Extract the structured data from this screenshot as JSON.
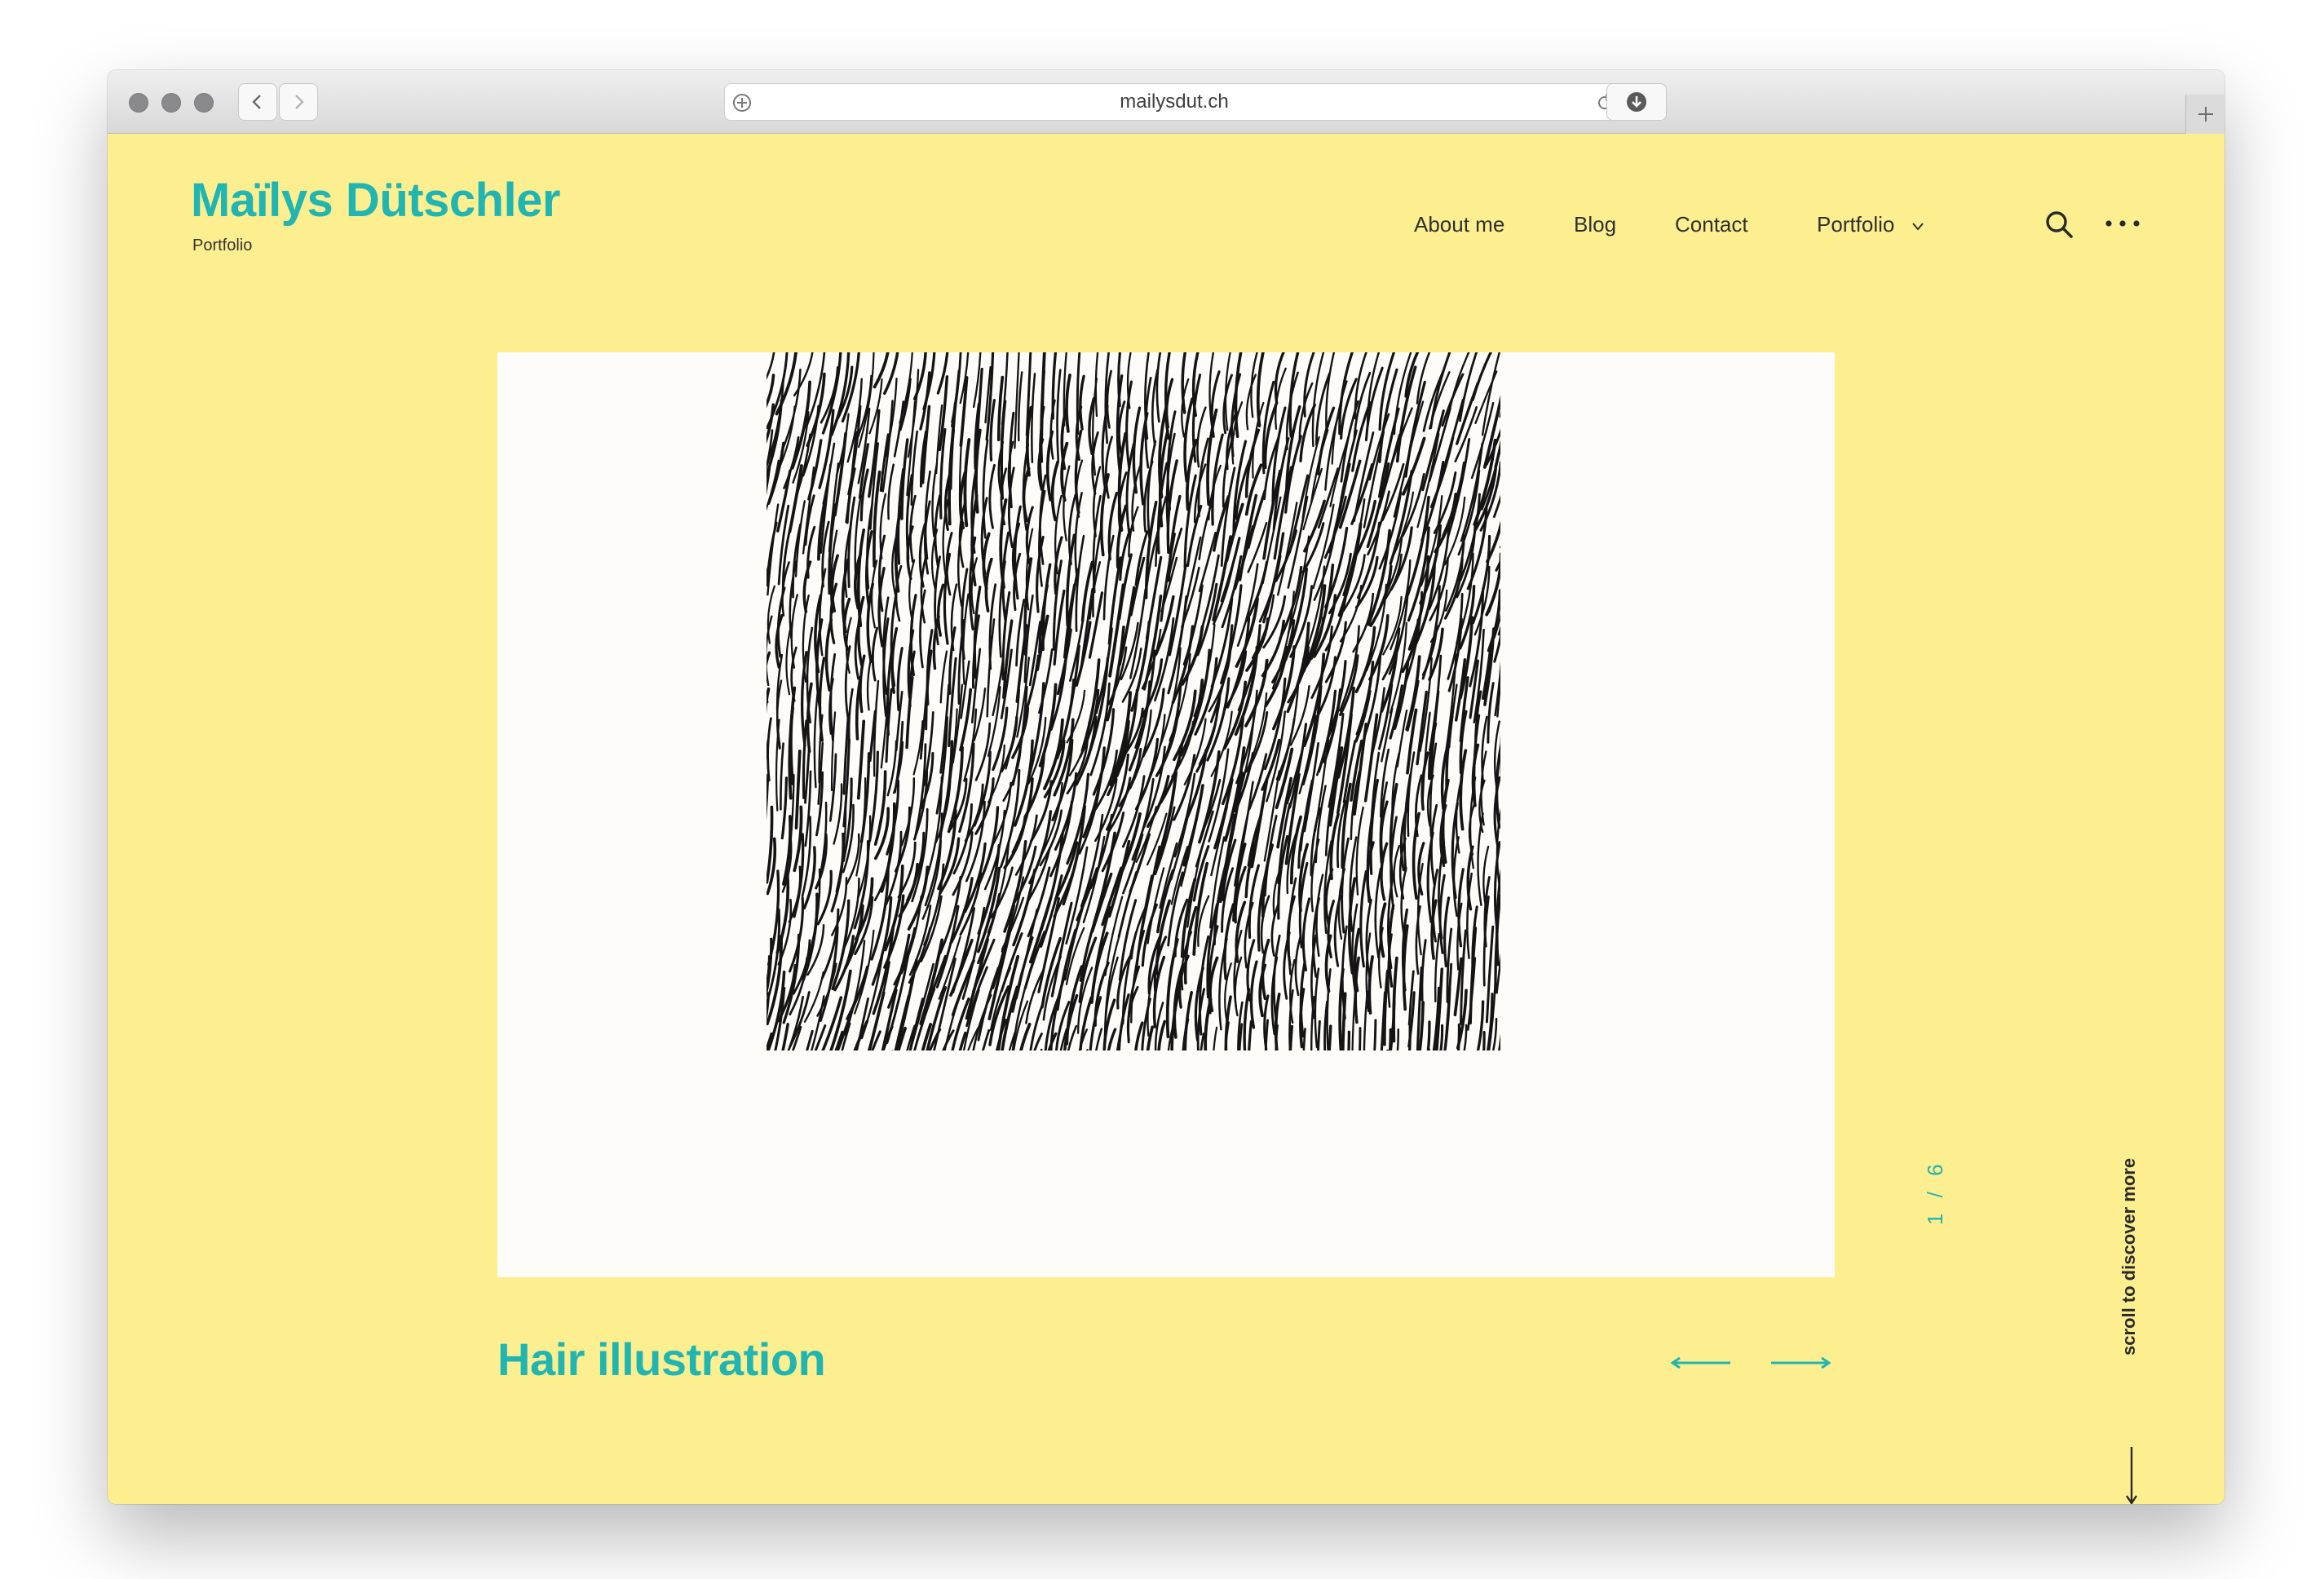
{
  "browser": {
    "url": "mailysdut.ch",
    "icons": {
      "back": "chevron-left-icon",
      "forward": "chevron-right-icon",
      "site_info": "circle-plus-icon",
      "reload": "reload-icon",
      "download": "download-icon",
      "new_tab": "plus-icon"
    }
  },
  "site": {
    "title": "Maïlys Dütschler",
    "subtitle": "Portfolio",
    "colors": {
      "accent": "#21b5b2",
      "background": "#fdef8f",
      "text": "#2f2f2f"
    }
  },
  "nav": {
    "items": [
      "About me",
      "Blog",
      "Contact",
      "Portfolio"
    ],
    "dropdown_icon": "chevron-down-icon",
    "search_icon": "search-icon",
    "more_icon": "more-dots-icon"
  },
  "slide": {
    "title": "Hair illustration",
    "current": "1",
    "total": "6",
    "counter": "1 / 6",
    "prev_icon": "arrow-left-icon",
    "next_icon": "arrow-right-icon"
  },
  "scroll_hint": {
    "text": "scroll to discover more",
    "icon": "arrow-down-icon"
  }
}
